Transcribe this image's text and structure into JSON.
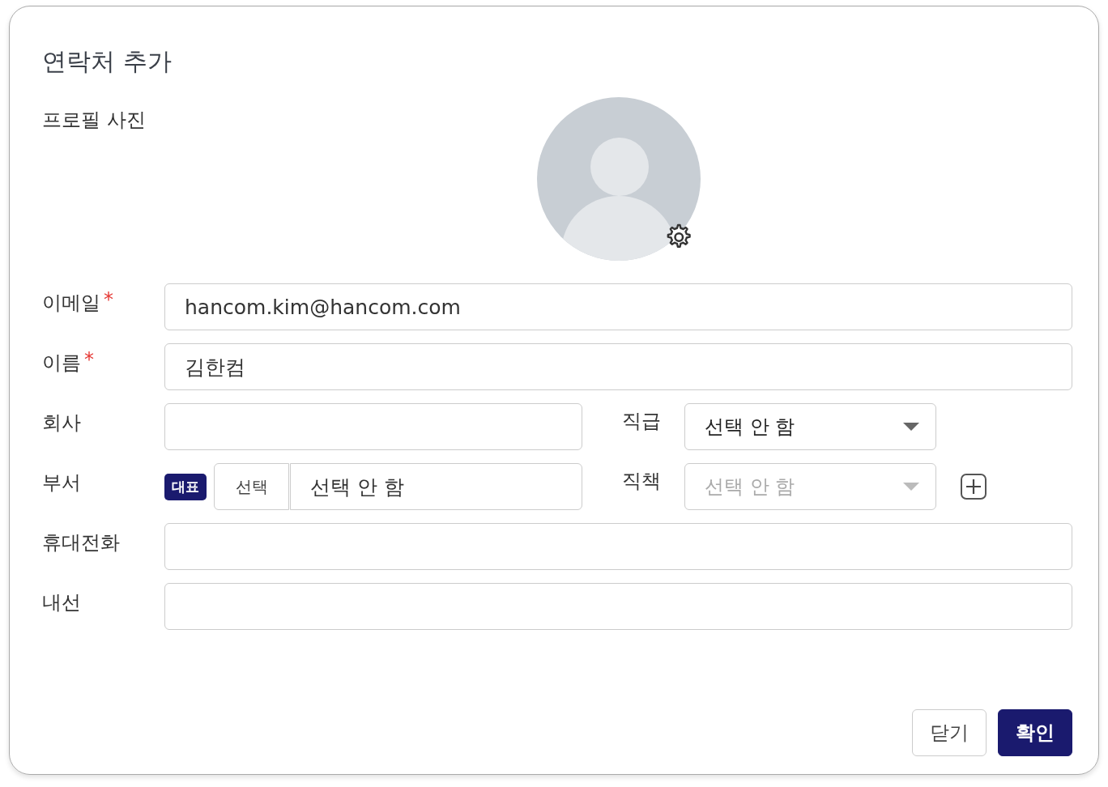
{
  "dialog": {
    "title": "연락처 추가"
  },
  "profile_photo": {
    "label": "프로필 사진"
  },
  "rows": [
    {
      "kind": "text",
      "label": "이메일",
      "required_mark": "*",
      "value": "hancom.kim@hancom.com"
    },
    {
      "kind": "text",
      "label": "이름",
      "required_mark": "*",
      "value": "김한컴"
    },
    {
      "kind": "split",
      "label": "회사",
      "side": {
        "label": "직급",
        "value": "선택 안 함",
        "disabled": false
      }
    },
    {
      "kind": "department",
      "label": "부서",
      "badge": "대표",
      "select_button": "선택",
      "value": "선택 안 함",
      "side": {
        "label": "직책",
        "value": "선택 안 함",
        "disabled": true,
        "add_button": true
      }
    },
    {
      "kind": "text",
      "label": "휴대전화"
    },
    {
      "kind": "text",
      "label": "내선"
    }
  ],
  "buttons": [
    {
      "label": "닫기",
      "kind": "secondary"
    },
    {
      "label": "확인",
      "kind": "primary"
    }
  ]
}
